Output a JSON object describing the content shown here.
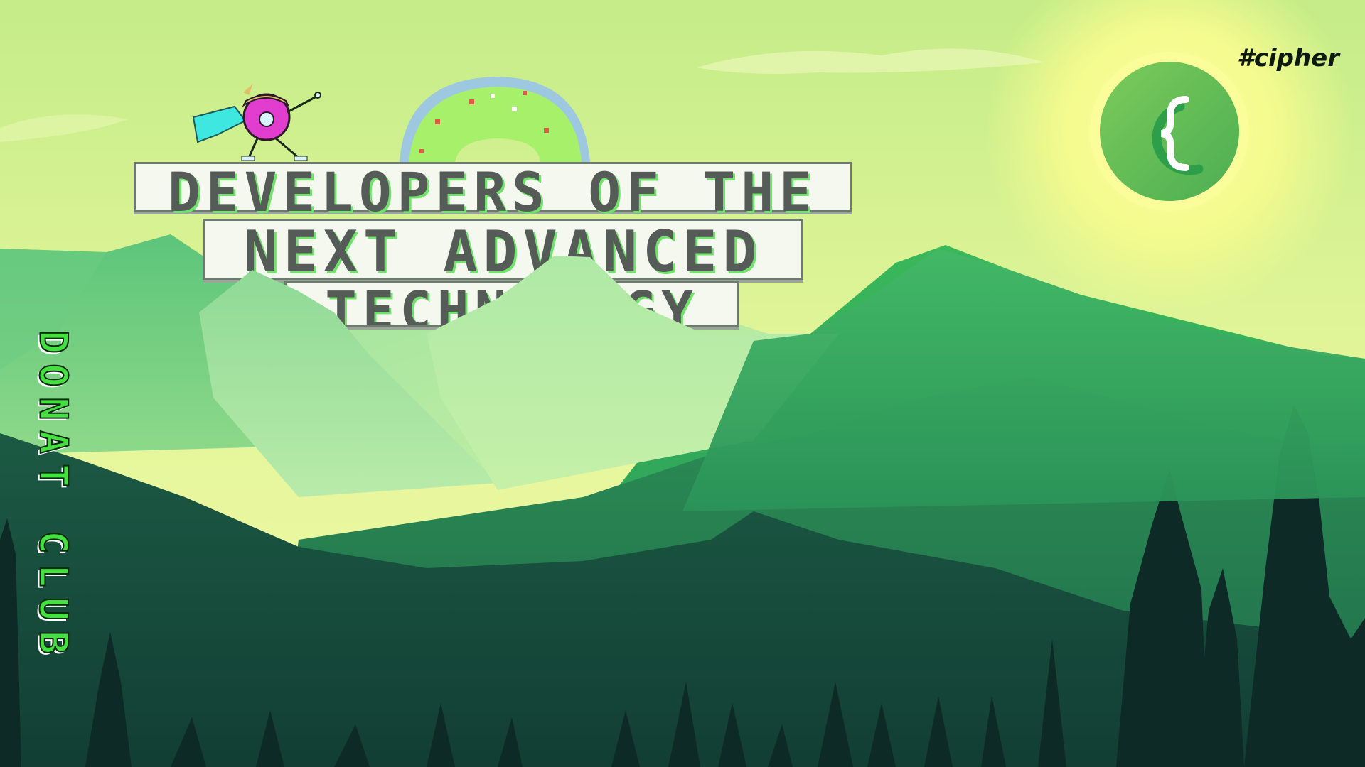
{
  "hashtag": "#cipher",
  "title": {
    "line1": "DEVELOPERS OF THE",
    "line2": "NEXT ADVANCED",
    "line3": "TECHNOLOGY"
  },
  "club_name": "DONAT CLUB",
  "logo": {
    "icon": "curly-brace-c-logo-icon",
    "color": "#5fbf4f"
  },
  "mascot": {
    "icon": "donut-superhero-mascot-icon"
  },
  "colors": {
    "sky_top": "#c8ec8a",
    "sun_glow": "#fbfd9a",
    "mountain_light": "#8fd98f",
    "mountain_mid": "#2fa85a",
    "forest_dark": "#0d2a24",
    "accent_green": "#44e040"
  }
}
